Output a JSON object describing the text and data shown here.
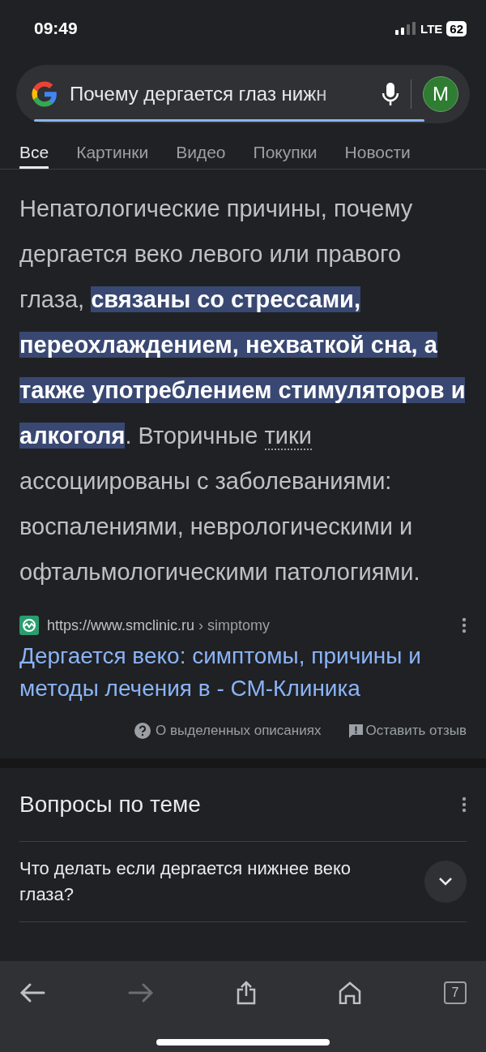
{
  "status_bar": {
    "time": "09:49",
    "network": "LTE",
    "battery": "62"
  },
  "search": {
    "query": "Почему дергается глаз нижн",
    "avatar": "M"
  },
  "tabs": [
    {
      "label": "Все",
      "selected": true
    },
    {
      "label": "Картинки",
      "selected": false
    },
    {
      "label": "Видео",
      "selected": false
    },
    {
      "label": "Покупки",
      "selected": false
    },
    {
      "label": "Новости",
      "selected": false
    }
  ],
  "featured_snippet": {
    "segments": [
      {
        "kind": "plain",
        "text": "Непатологические причины, почему дергается веко левого или правого глаза, "
      },
      {
        "kind": "highlight",
        "text": "связаны со стрессами, переохлаждением, нехваткой сна, а также употреблением стимуляторов и алкоголя"
      },
      {
        "kind": "plain",
        "text": ". Вторичные "
      },
      {
        "kind": "term",
        "text": "тики"
      },
      {
        "kind": "plain",
        "text": " ассоциированы с заболеваниями: воспалениями, неврологическими и офтальмологическими патологиями."
      }
    ],
    "source_url": "https://www.smclinic.ru",
    "source_path": "› simptomy",
    "title": "Дергается веко: симптомы, причины и методы лечения в - СМ-Клиника",
    "about_link": "О выделенных описаниях",
    "feedback_link": "Оставить отзыв"
  },
  "related_questions": {
    "title": "Вопросы по теме",
    "items": [
      {
        "text": "Что делать если дергается нижнее веко глаза?",
        "expanded": false
      }
    ]
  },
  "toolbar": {
    "tab_count": "7"
  }
}
